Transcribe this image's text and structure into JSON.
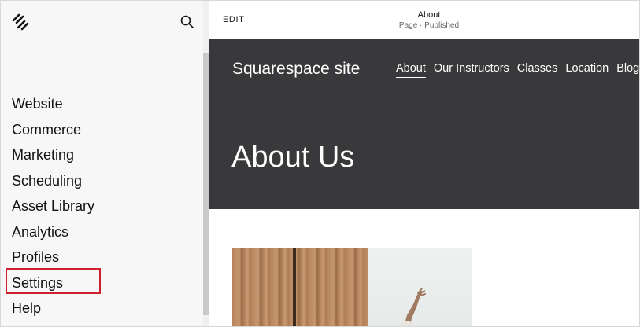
{
  "sidebar": {
    "logo_icon": "squarespace-logo-icon",
    "search_icon": "search-icon",
    "items": [
      {
        "label": "Website"
      },
      {
        "label": "Commerce"
      },
      {
        "label": "Marketing"
      },
      {
        "label": "Scheduling"
      },
      {
        "label": "Asset Library"
      },
      {
        "label": "Analytics"
      },
      {
        "label": "Profiles"
      },
      {
        "label": "Settings",
        "highlighted": true
      },
      {
        "label": "Help"
      }
    ],
    "highlight_color": "#d0202e"
  },
  "topbar": {
    "edit_label": "EDIT",
    "page_title": "About",
    "page_status": "Page · Published"
  },
  "site": {
    "title": "Squarespace site",
    "nav": [
      "About",
      "Our Instructors",
      "Classes",
      "Location",
      "Blog"
    ],
    "active_nav": "About",
    "hero_heading": "About Us",
    "hero_bg": "#39383a"
  }
}
